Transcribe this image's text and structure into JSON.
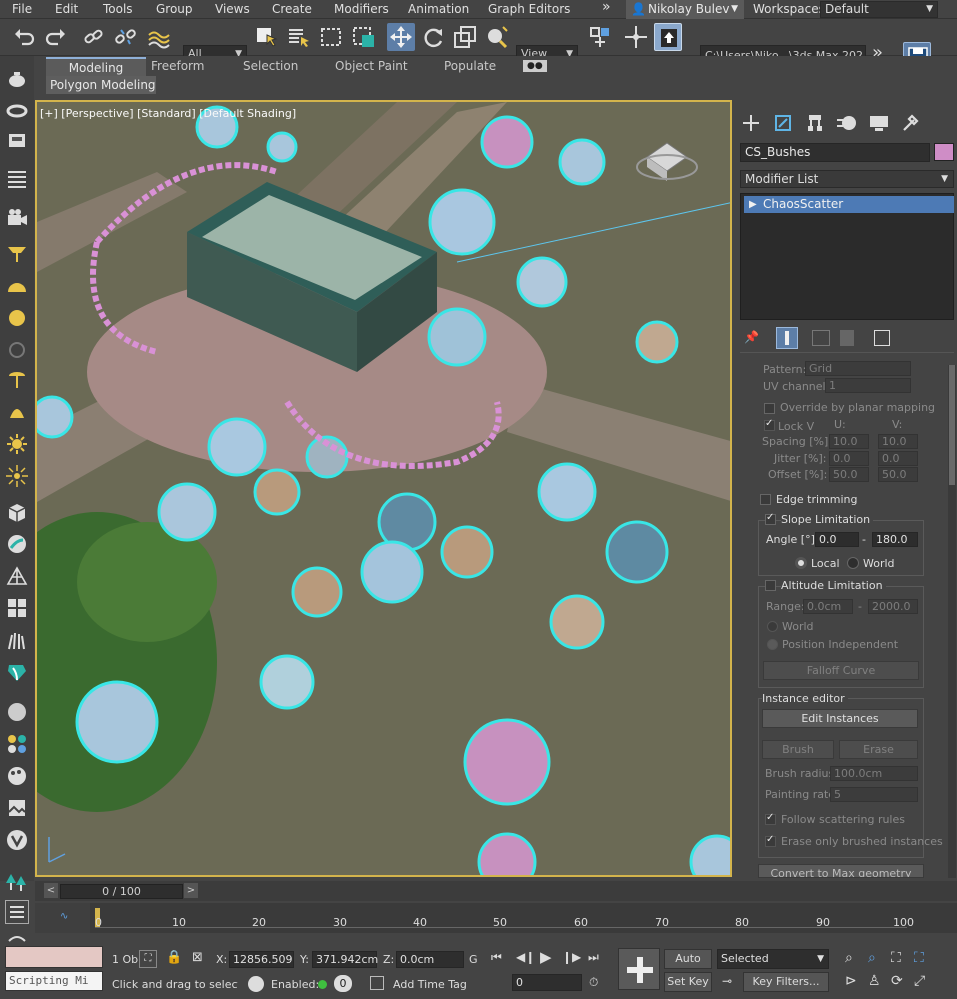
{
  "menubar": {
    "items": [
      "File",
      "Edit",
      "Tools",
      "Group",
      "Views",
      "Create",
      "Modifiers",
      "Animation",
      "Graph Editors"
    ],
    "more": "»",
    "user": "Nikolay Bulev",
    "workspaces_label": "Workspaces:",
    "workspace_value": "Default"
  },
  "toolbar": {
    "selection_filter": "All",
    "ref_coord": "View",
    "path": "C:\\Users\\Niko...\\3ds Max 202",
    "more": "»"
  },
  "ribbon": {
    "tabs": [
      "Modeling",
      "Freeform",
      "Selection",
      "Object Paint",
      "Populate"
    ],
    "active": "Modeling",
    "sub": "Polygon Modeling"
  },
  "viewport": {
    "label": "[+] [Perspective] [Standard] [Default Shading]"
  },
  "command_panel": {
    "object_name": "CS_Bushes",
    "object_color": "#cf8dc6",
    "modifier_list": "Modifier List",
    "stack_item": "ChaosScatter",
    "rows": {
      "pattern_label": "Pattern:",
      "pattern_value": "Grid",
      "uv_label": "UV channel:",
      "uv_value": "1",
      "override": "Override by planar mapping",
      "lockv": "Lock V",
      "u_label": "U:",
      "v_label": "V:",
      "spacing_label": "Spacing [%]:",
      "spacing_u": "10.0",
      "spacing_v": "10.0",
      "jitter_label": "Jitter [%]:",
      "jitter_u": "0.0",
      "jitter_v": "0.0",
      "offset_label": "Offset [%]:",
      "offset_u": "50.0",
      "offset_v": "50.0",
      "edge_trimming": "Edge trimming",
      "slope_limitation": "Slope Limitation",
      "angle_label": "Angle [°]:",
      "angle_min": "0.0",
      "angle_dash": "-",
      "angle_max": "180.0",
      "local": "Local",
      "world": "World",
      "altitude_limitation": "Altitude Limitation",
      "range_label": "Range:",
      "range_min": "0.0cm",
      "range_max": "2000.0",
      "alt_world": "World",
      "alt_position": "Position Independent",
      "falloff": "Falloff Curve",
      "instance_editor": "Instance editor",
      "edit_instances": "Edit Instances",
      "brush": "Brush",
      "erase": "Erase",
      "brush_radius_label": "Brush radius:",
      "brush_radius": "100.0cm",
      "painting_rate_label": "Painting rate:",
      "painting_rate": "5",
      "follow_rules": "Follow scattering rules",
      "erase_brushed": "Erase only brushed instances",
      "convert": "Convert to Max geometry"
    }
  },
  "timeline": {
    "frame": "0 / 100",
    "ticks": [
      "0",
      "10",
      "20",
      "30",
      "40",
      "50",
      "60",
      "70",
      "80",
      "90",
      "100"
    ]
  },
  "status": {
    "maxscript": "Scripting Mi",
    "objects": "1 Ob",
    "prompt": "Click and drag to select ar",
    "x_label": "X:",
    "x_value": "12856.509",
    "y_label": "Y:",
    "y_value": "371.942cm",
    "z_label": "Z:",
    "z_value": "0.0cm",
    "g_label": "G",
    "enabled_label": "Enabled:",
    "enabled_value": "0",
    "add_time_tag": "Add Time Tag",
    "frame_field": "0",
    "auto_key": "Auto Key",
    "set_key": "Set Key",
    "selected": "Selected",
    "key_filters": "Key Filters..."
  }
}
